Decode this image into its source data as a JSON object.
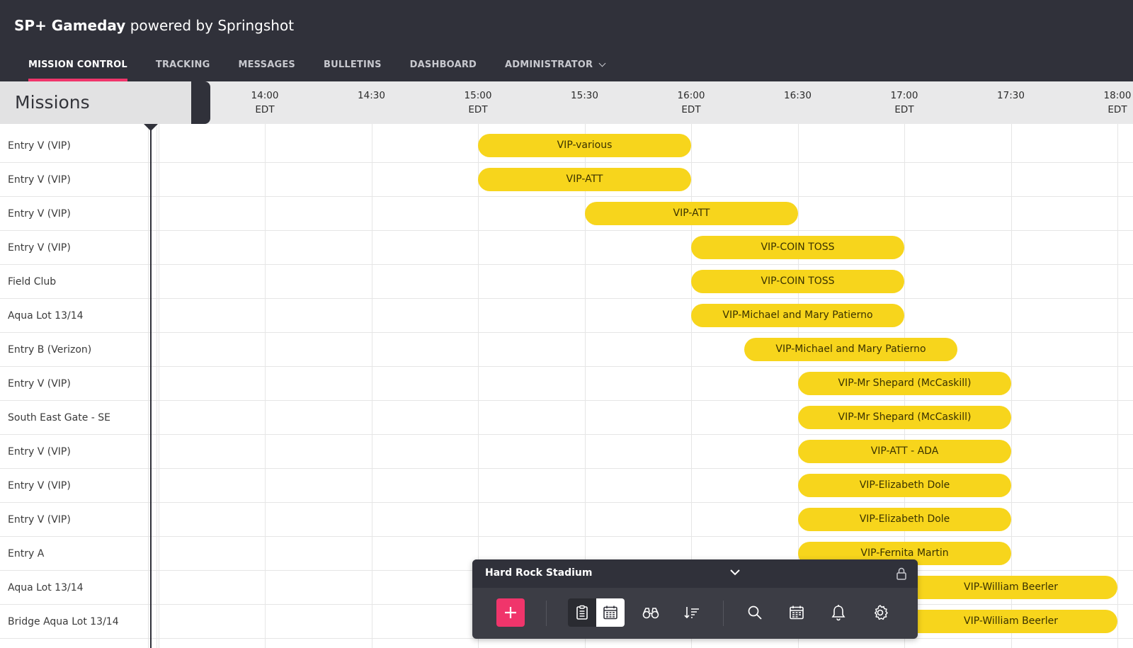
{
  "app": {
    "brand_bold": "SP+ Gameday",
    "brand_light": "powered by Springshot"
  },
  "nav": {
    "items": [
      {
        "label": "MISSION CONTROL",
        "active": true
      },
      {
        "label": "TRACKING",
        "active": false
      },
      {
        "label": "MESSAGES",
        "active": false
      },
      {
        "label": "BULLETINS",
        "active": false
      },
      {
        "label": "DASHBOARD",
        "active": false
      },
      {
        "label": "ADMINISTRATOR",
        "active": false,
        "dropdown": true
      }
    ]
  },
  "timeline": {
    "title": "Missions",
    "ticks": [
      {
        "time": "14:00",
        "tz": "EDT"
      },
      {
        "time": "14:30",
        "tz": ""
      },
      {
        "time": "15:00",
        "tz": "EDT"
      },
      {
        "time": "15:30",
        "tz": ""
      },
      {
        "time": "16:00",
        "tz": "EDT"
      },
      {
        "time": "16:30",
        "tz": ""
      },
      {
        "time": "17:00",
        "tz": "EDT"
      },
      {
        "time": "17:30",
        "tz": ""
      },
      {
        "time": "18:00",
        "tz": "EDT"
      }
    ],
    "rows": [
      {
        "label": "Entry V (VIP)",
        "mission": "VIP-various",
        "start": "15:00",
        "end": "16:00"
      },
      {
        "label": "Entry V (VIP)",
        "mission": "VIP-ATT",
        "start": "15:00",
        "end": "16:00"
      },
      {
        "label": "Entry V (VIP)",
        "mission": "VIP-ATT",
        "start": "15:30",
        "end": "16:30"
      },
      {
        "label": "Entry V (VIP)",
        "mission": "VIP-COIN TOSS",
        "start": "16:00",
        "end": "17:00"
      },
      {
        "label": "Field Club",
        "mission": "VIP-COIN TOSS",
        "start": "16:00",
        "end": "17:00"
      },
      {
        "label": "Aqua Lot 13/14",
        "mission": "VIP-Michael and Mary Patierno",
        "start": "16:00",
        "end": "17:00"
      },
      {
        "label": "Entry B (Verizon)",
        "mission": "VIP-Michael and Mary Patierno",
        "start": "16:15",
        "end": "17:15"
      },
      {
        "label": "Entry V (VIP)",
        "mission": "VIP-Mr Shepard (McCaskill)",
        "start": "16:30",
        "end": "17:30"
      },
      {
        "label": "South East Gate - SE",
        "mission": "VIP-Mr Shepard (McCaskill)",
        "start": "16:30",
        "end": "17:30"
      },
      {
        "label": "Entry V (VIP)",
        "mission": "VIP-ATT - ADA",
        "start": "16:30",
        "end": "17:30"
      },
      {
        "label": "Entry V (VIP)",
        "mission": "VIP-Elizabeth Dole",
        "start": "16:30",
        "end": "17:30"
      },
      {
        "label": "Entry V (VIP)",
        "mission": "VIP-Elizabeth Dole",
        "start": "16:30",
        "end": "17:30"
      },
      {
        "label": "Entry A",
        "mission": "VIP-Fernita Martin",
        "start": "16:30",
        "end": "17:30"
      },
      {
        "label": "Aqua Lot 13/14",
        "mission": "VIP-William Beerler",
        "start": "17:00",
        "end": "18:00"
      },
      {
        "label": "Bridge Aqua Lot 13/14",
        "mission": "VIP-William Beerler",
        "start": "17:00",
        "end": "18:00"
      }
    ]
  },
  "toolbar": {
    "venue": "Hard Rock Stadium",
    "tools": [
      {
        "icon": "plus-icon",
        "name": "add-mission-button"
      },
      {
        "icon": "clipboard-icon",
        "name": "list-view-button"
      },
      {
        "icon": "calendar-grid-icon",
        "name": "timeline-view-button"
      },
      {
        "icon": "binoculars-icon",
        "name": "watch-button"
      },
      {
        "icon": "sort-icon",
        "name": "sort-button"
      },
      {
        "icon": "search-icon",
        "name": "search-button"
      },
      {
        "icon": "calendar-icon",
        "name": "calendar-button"
      },
      {
        "icon": "bell-icon",
        "name": "notifications-button"
      },
      {
        "icon": "gear-icon",
        "name": "settings-button"
      }
    ]
  },
  "colors": {
    "header_bg": "#30313a",
    "accent": "#f0356b",
    "mission_bar": "#f7d51c"
  }
}
